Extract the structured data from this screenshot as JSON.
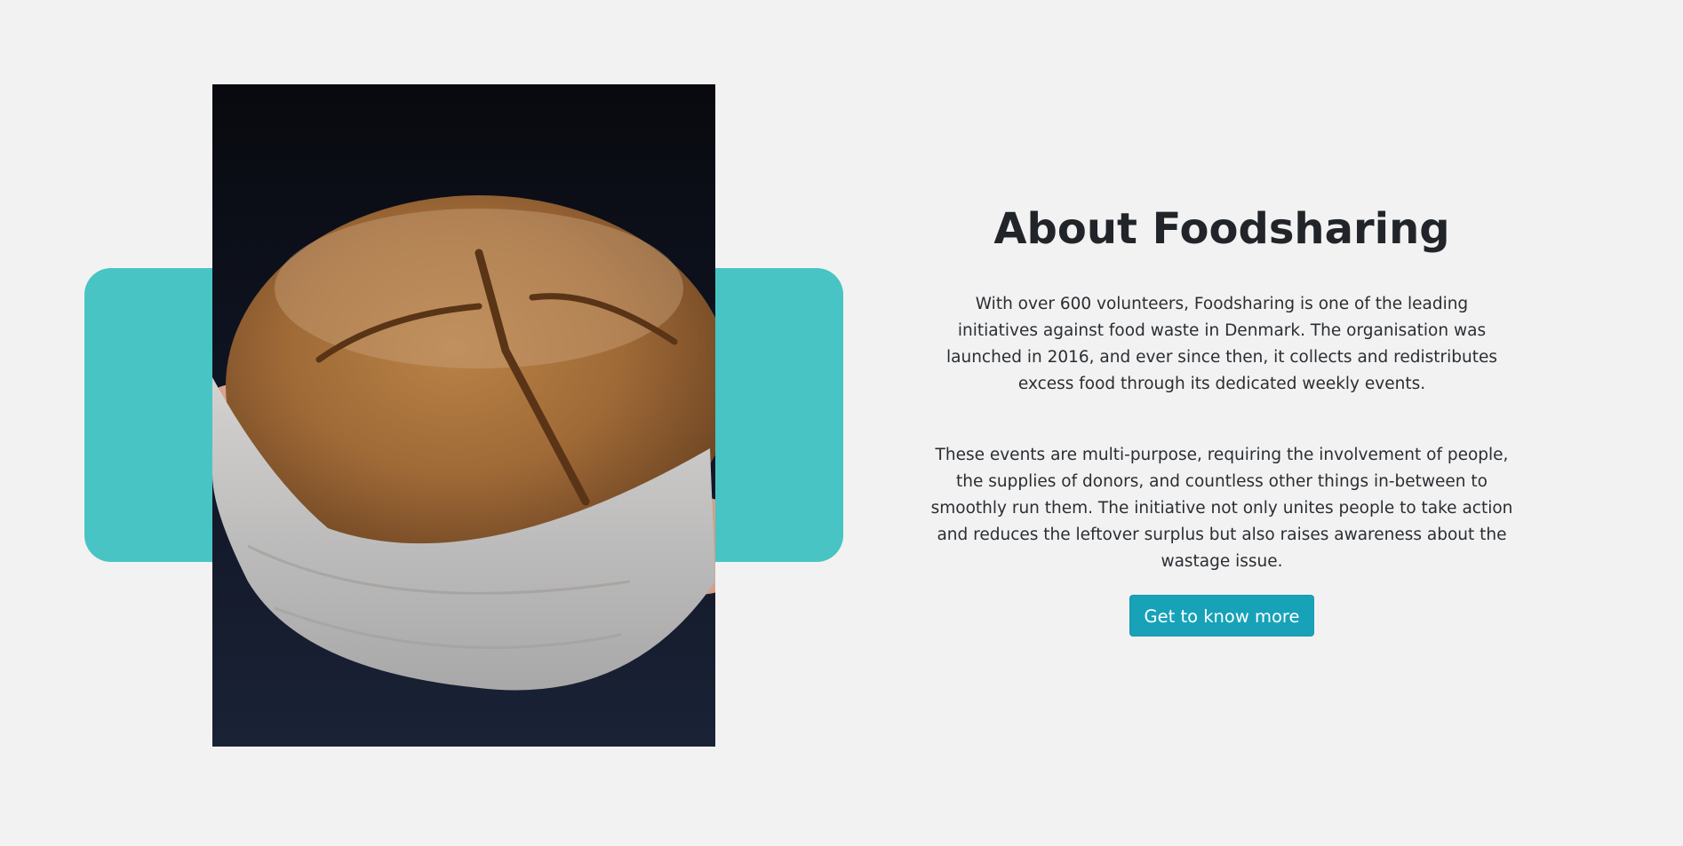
{
  "about": {
    "title": "About Foodsharing",
    "paragraph_1": "With over 600 volunteers, Foodsharing is one of the leading initiatives against food waste in Denmark. The organisation was launched in 2016, and ever since then, it collects and redistributes excess food through its dedicated weekly events.",
    "paragraph_2": "These events are multi-purpose, requiring the involvement of people, the supplies of donors, and countless other things in-between to smoothly run them. The initiative not only unites people to take action and reduces the leftover surplus but also raises awareness about the wastage issue.",
    "cta_label": "Get to know more"
  },
  "colors": {
    "background": "#f2f2f2",
    "accent_block": "#48c4c4",
    "button": "#17a2b8",
    "text": "#212529"
  }
}
